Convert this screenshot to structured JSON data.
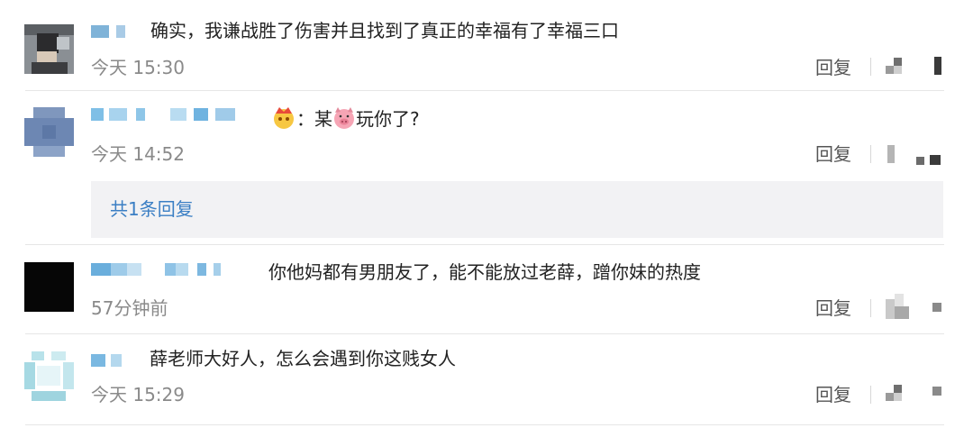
{
  "colors": {
    "link": "#3b7fc4",
    "text": "#222222",
    "meta": "#8a8a8a",
    "reply_box_bg": "#f2f2f4"
  },
  "comments": [
    {
      "text": "确实，我谦战胜了伤害并且找到了真正的幸福有了幸福三口",
      "time": "今天 15:30",
      "reply_label": "回复",
      "avatar_icon": "blurred-avatar-icon"
    },
    {
      "text_prefix": "：某",
      "text_suffix": "玩你了?",
      "time": "今天 14:52",
      "reply_label": "回复",
      "avatar_icon": "blurred-avatar-icon",
      "badge_icon": "crown-emoji-icon",
      "inline_icon": "pig-emoji-icon",
      "replies_summary": "共1条回复"
    },
    {
      "text": "你他妈都有男朋友了，能不能放过老薛，蹭你妹的热度",
      "time": "57分钟前",
      "reply_label": "回复",
      "avatar_icon": "blurred-avatar-icon"
    },
    {
      "text": "薛老师大好人，怎么会遇到你这贱女人",
      "time": "今天 15:29",
      "reply_label": "回复",
      "avatar_icon": "blurred-avatar-icon"
    }
  ]
}
